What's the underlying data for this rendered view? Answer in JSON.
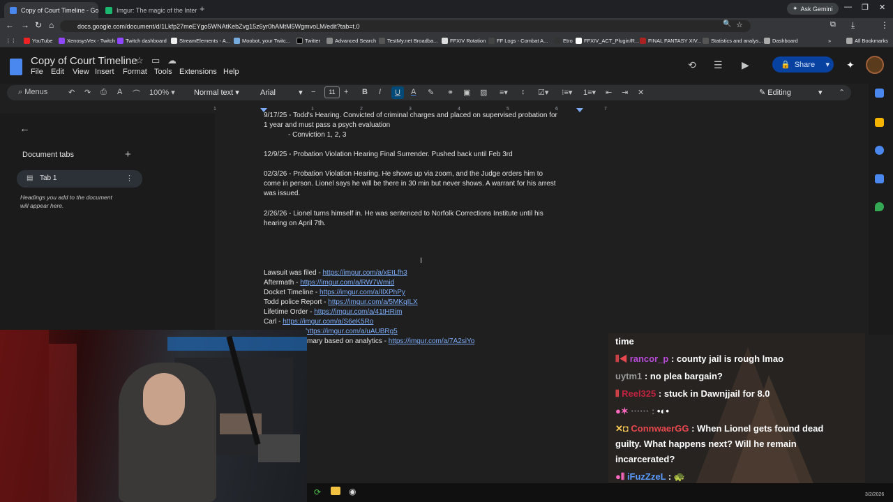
{
  "browser": {
    "tabs": [
      {
        "title": "Copy of Court Timeline - Goog",
        "active": true
      },
      {
        "title": "Imgur: The magic of the Intern",
        "active": false
      }
    ],
    "url": "docs.google.com/document/d/1Lkfp27meEYgo5WNAtKebZvg15z6yr0hAMtM5WgmvoLM/edit?tab=t.0",
    "ask_gemini": "Ask Gemini",
    "bookmarks": [
      "YouTube",
      "XenosysVex - Twitch",
      "Twitch dashboard",
      "StreamElements - A...",
      "Moobot, your Twitc...",
      "Twitter",
      "Advanced Search",
      "TestMy.net Broadba...",
      "FFXIV Rotation",
      "FF Logs - Combat A...",
      "Etro",
      "FFXIV_ACT_Plugin/R...",
      "FINAL FANTASY XIV...",
      "Statistics and analys...",
      "Dashboard"
    ],
    "all_bookmarks": "All Bookmarks"
  },
  "docs": {
    "title": "Copy of Court Timeline",
    "menus": [
      "File",
      "Edit",
      "View",
      "Insert",
      "Format",
      "Tools",
      "Extensions",
      "Help"
    ],
    "share_label": "Share",
    "toolbar": {
      "menus_search": "Menus",
      "zoom": "100%",
      "style": "Normal text",
      "font": "Arial",
      "font_size": "11",
      "mode": "Editing"
    },
    "ruler_numbers": [
      "1",
      "1",
      "2",
      "3",
      "4",
      "5",
      "6",
      "7"
    ],
    "sidebar": {
      "heading": "Document tabs",
      "tab_label": "Tab 1",
      "hint_line1": "Headings you add to the document",
      "hint_line2": "will appear here."
    },
    "body": {
      "line1": "9/17/25 - Todd's Hearing. Convicted of criminal charges and placed on supervised probation for",
      "line2": "1 year and must pass a psych evaluation",
      "line3": "- Conviction 1, 2, 3",
      "line4": "12/9/25 - Probation Violation Hearing Final Surrender. Pushed back until Feb 3rd",
      "line5": "02/3/26 - Probation Violation Hearing. He shows up via zoom, and the Judge orders him to",
      "line6": "come in person. Lionel says he will be there in 30 min but never shows. A warrant for his arrest",
      "line7": "was issued.",
      "line8": "2/26/26 - Lionel turns himself in. He was sentenced to Norfolk Corrections Institute until his",
      "line9": "hearing on April 7th."
    },
    "links": [
      {
        "label": "Lawsuit was filed - ",
        "url": "https://imgur.com/a/xEtLfh3"
      },
      {
        "label": "Aftermath - ",
        "url": "https://imgur.com/a/RW7Wmid"
      },
      {
        "label": "Docket Timeline - ",
        "url": "https://imgur.com/a/IlXPhPy"
      },
      {
        "label": "Todd police Report - ",
        "url": "https://imgur.com/a/5MKqILX"
      },
      {
        "label": "Lifetime Order - ",
        "url": "https://imgur.com/a/41tHRim"
      },
      {
        "label": "Carl - ",
        "url": "https://imgur.com/a/S6eK5Ro"
      },
      {
        "label": "",
        "url": "https://imgur.com/a/uAUBRg5"
      },
      {
        "label": "mary based on analytics - ",
        "url": "https://imgur.com/a/7A2siYo"
      }
    ]
  },
  "chat": {
    "top_fragment": "time",
    "messages": [
      {
        "user": "rancor_p",
        "color": "#b84ad8",
        "text": "county jail is rough lmao"
      },
      {
        "user": "uytm1",
        "color": "#9a9a9a",
        "text": "no plea bargain?"
      },
      {
        "user": "Reel325",
        "color": "#c0233f",
        "text": "stuck in Dawnjjail for 8.0"
      },
      {
        "user": "ConnwaerGG",
        "color": "#e8474d",
        "text": "When Lionel gets found dead"
      },
      {
        "user": "",
        "color": "#ffffff",
        "text": "guilty. What happens next? Will he remain"
      },
      {
        "user": "",
        "color": "#ffffff",
        "text": "incarcerated?"
      },
      {
        "user": "iFuzZzeL",
        "color": "#5a9bff",
        "text": ""
      }
    ]
  },
  "taskbar": {
    "date": "3/2/2026"
  }
}
